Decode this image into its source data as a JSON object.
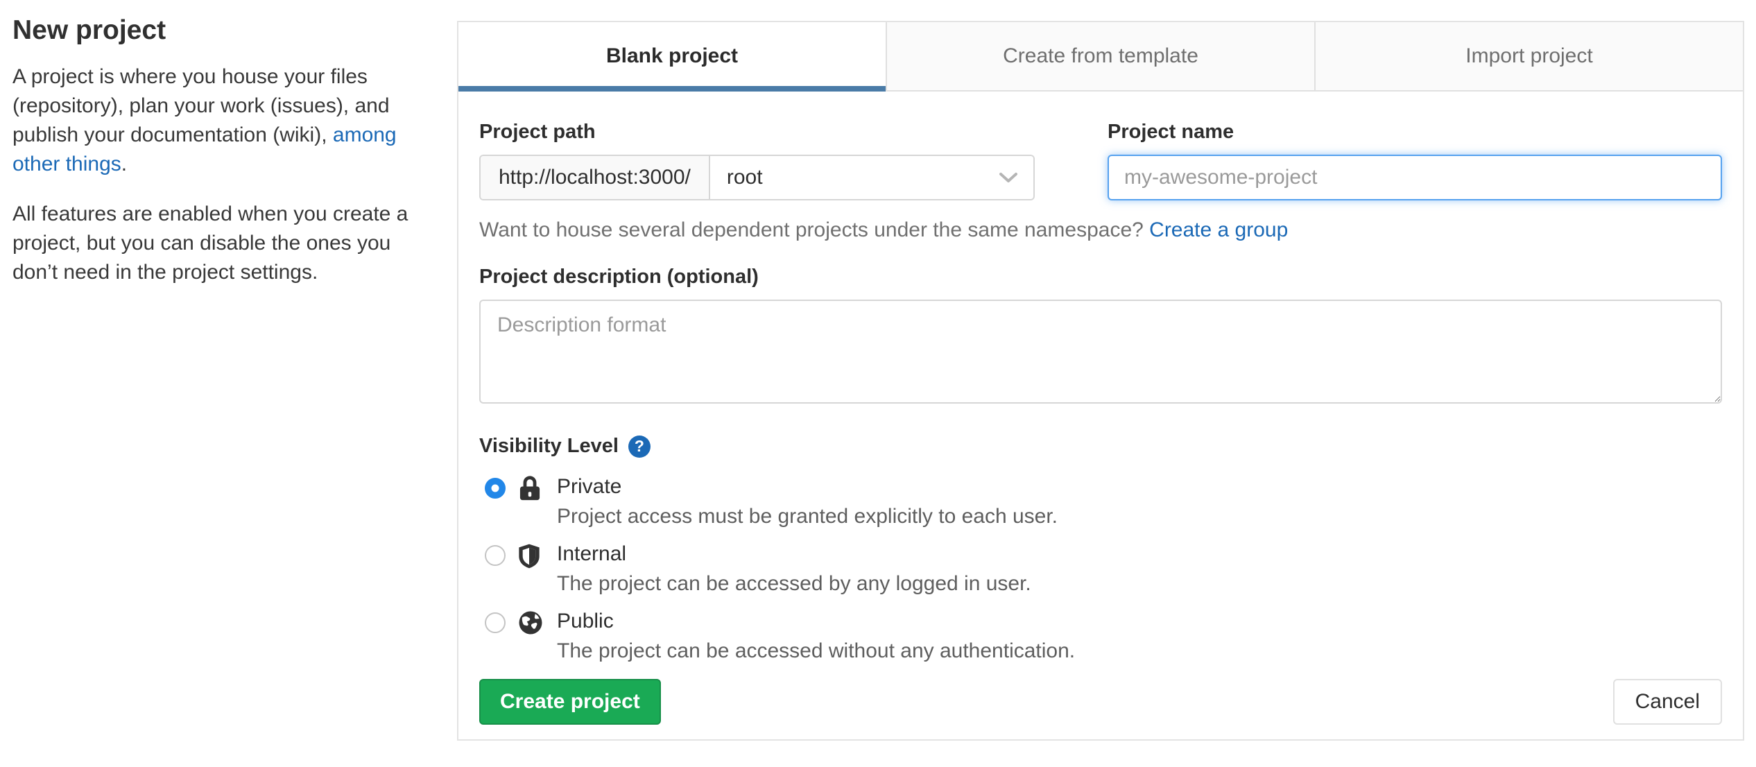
{
  "sidebar": {
    "title": "New project",
    "intro_text": "A project is where you house your files (repository), plan your work (issues), and publish your documentation (wiki), ",
    "intro_link": "among other things",
    "intro_suffix": ".",
    "features_text": "All features are enabled when you create a project, but you can disable the ones you don’t need in the project settings."
  },
  "tabs": [
    {
      "label": "Blank project",
      "active": true
    },
    {
      "label": "Create from template",
      "active": false
    },
    {
      "label": "Import project",
      "active": false
    }
  ],
  "form": {
    "project_path": {
      "label": "Project path",
      "url_prefix": "http://localhost:3000/",
      "namespace_selected": "root"
    },
    "project_name": {
      "label": "Project name",
      "placeholder": "my-awesome-project",
      "value": ""
    },
    "namespace_hint": {
      "text": "Want to house several dependent projects under the same namespace? ",
      "link": "Create a group"
    },
    "description": {
      "label": "Project description (optional)",
      "placeholder": "Description format",
      "value": ""
    },
    "visibility": {
      "label": "Visibility Level",
      "help_glyph": "?",
      "options": [
        {
          "name": "Private",
          "icon": "lock-icon",
          "selected": true,
          "description": "Project access must be granted explicitly to each user."
        },
        {
          "name": "Internal",
          "icon": "shield-icon",
          "selected": false,
          "description": "The project can be accessed by any logged in user."
        },
        {
          "name": "Public",
          "icon": "globe-icon",
          "selected": false,
          "description": "The project can be accessed without any authentication."
        }
      ]
    },
    "submit_label": "Create project",
    "cancel_label": "Cancel"
  },
  "colors": {
    "accent_green": "#1aaa55",
    "link_blue": "#1b69b6",
    "tab_underline_blue": "#4a7ba7",
    "radio_selected_blue": "#2287e8",
    "focus_border_blue": "#55a1ef"
  }
}
